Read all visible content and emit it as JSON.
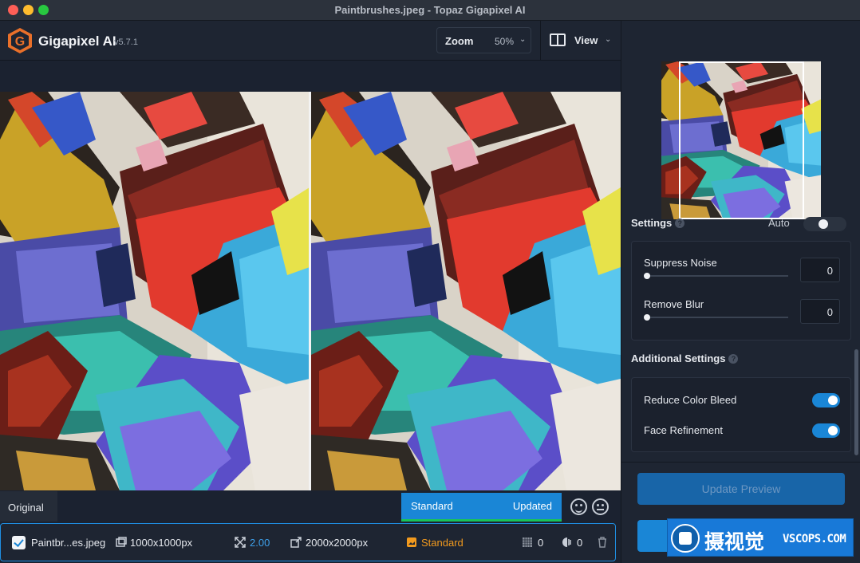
{
  "window": {
    "title": "Paintbrushes.jpeg - Topaz Gigapixel AI"
  },
  "app": {
    "name": "Gigapixel AI",
    "version": "v5.7.1"
  },
  "toolbar": {
    "zoom_label": "Zoom",
    "zoom_value": "50%",
    "view_label": "View"
  },
  "preview": {
    "original_label": "Original",
    "model_name": "Standard",
    "status": "Updated"
  },
  "file": {
    "checked": true,
    "name": "Paintbr...es.jpeg",
    "input_size": "1000x1000px",
    "scale": "2.00",
    "output_size": "2000x2000px",
    "model": "Standard",
    "noise_count": "0",
    "blur_count": "0"
  },
  "settings": {
    "header": "Settings",
    "auto_label": "Auto",
    "suppress_noise": {
      "label": "Suppress Noise",
      "value": "0"
    },
    "remove_blur": {
      "label": "Remove Blur",
      "value": "0"
    },
    "additional_header": "Additional Settings",
    "reduce_color_bleed": {
      "label": "Reduce Color Bleed",
      "on": true
    },
    "face_refinement": {
      "label": "Face Refinement",
      "on": true
    },
    "update_button": "Update Preview"
  },
  "watermark": {
    "cn": "摄视觉",
    "en": "VSCOPS.COM"
  },
  "colors": {
    "accent": "#1a86d6",
    "success": "#19c25a",
    "model_orange": "#f29a1e",
    "panel_bg": "#1e2532"
  }
}
